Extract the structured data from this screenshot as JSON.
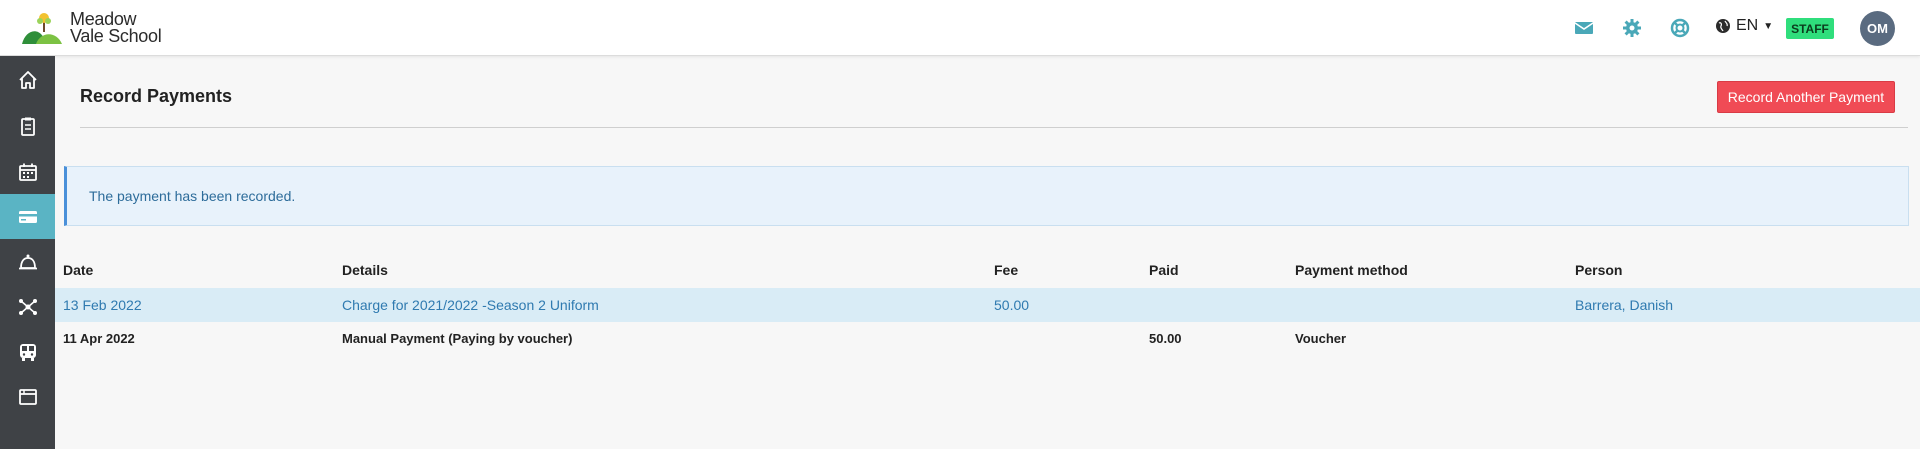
{
  "brand": {
    "line1": "Meadow",
    "line2": "Vale School"
  },
  "header": {
    "language": "EN",
    "role_badge": "STAFF",
    "avatar_initials": "OM",
    "icons": [
      "envelope-icon",
      "gear-icon",
      "lifebuoy-icon",
      "globe-icon"
    ]
  },
  "sidebar": {
    "items": [
      {
        "name": "home",
        "icon": "home-icon",
        "active": false
      },
      {
        "name": "clipboard",
        "icon": "clipboard-icon",
        "active": false
      },
      {
        "name": "calendar",
        "icon": "calendar-icon",
        "active": false
      },
      {
        "name": "payments",
        "icon": "credit-card-icon",
        "active": true
      },
      {
        "name": "bell",
        "icon": "bell-icon",
        "active": false
      },
      {
        "name": "network",
        "icon": "network-icon",
        "active": false
      },
      {
        "name": "bus",
        "icon": "bus-icon",
        "active": false
      },
      {
        "name": "window",
        "icon": "window-icon",
        "active": false
      }
    ]
  },
  "page": {
    "title": "Record Payments",
    "record_another_label": "Record Another Payment",
    "alert": "The payment has been recorded."
  },
  "table": {
    "headers": [
      "Date",
      "Details",
      "Fee",
      "Paid",
      "Payment method",
      "Person"
    ],
    "rows": [
      {
        "date": "13 Feb 2022",
        "details": "Charge for 2021/2022 -Season 2 Uniform",
        "fee": "50.00",
        "paid": "",
        "method": "",
        "person": "Barrera, Danish"
      },
      {
        "date": "11 Apr 2022",
        "details": "Manual Payment (Paying by voucher)",
        "fee": "",
        "paid": "50.00",
        "method": "Voucher",
        "person": ""
      }
    ]
  },
  "colors": {
    "accent": "#5ab4c4",
    "primary_button": "#f04b55",
    "staff_badge": "#2fde7c",
    "sidebar_bg": "#3f4246",
    "link": "#2f7ab0"
  }
}
